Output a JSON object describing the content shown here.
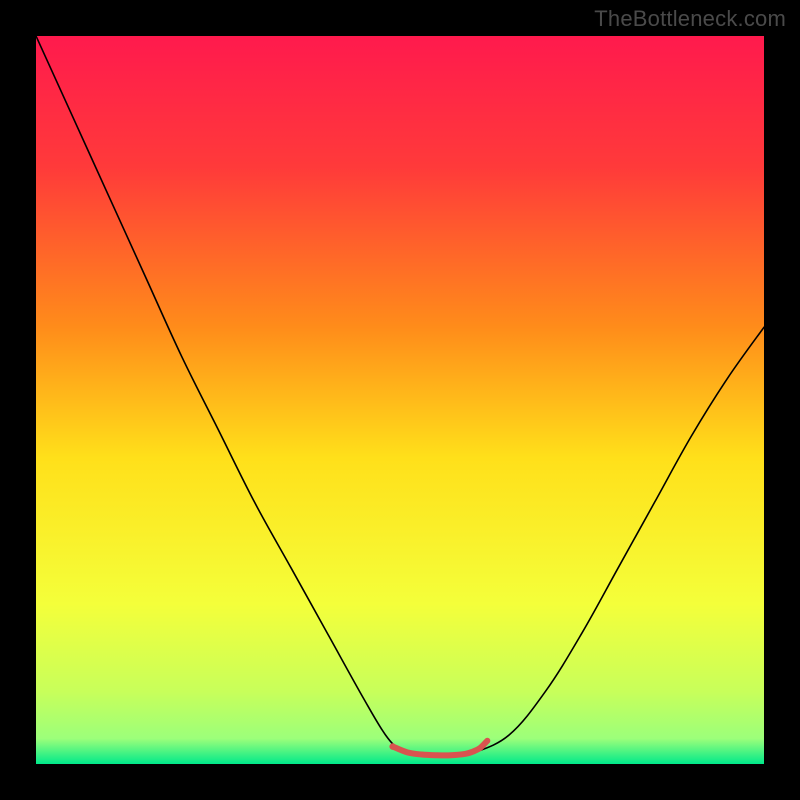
{
  "watermark": "TheBottleneck.com",
  "chart_data": {
    "type": "line",
    "title": "",
    "xlabel": "",
    "ylabel": "",
    "xlim": [
      0,
      100
    ],
    "ylim": [
      0,
      100
    ],
    "grid": false,
    "background_gradient_type": "vertical",
    "background_gradient_stops": [
      {
        "offset": 0.0,
        "color": "#ff1a4d"
      },
      {
        "offset": 0.18,
        "color": "#ff3a3a"
      },
      {
        "offset": 0.4,
        "color": "#ff8c1a"
      },
      {
        "offset": 0.58,
        "color": "#ffe01a"
      },
      {
        "offset": 0.78,
        "color": "#f4ff3a"
      },
      {
        "offset": 0.9,
        "color": "#c8ff5a"
      },
      {
        "offset": 0.965,
        "color": "#9cff7a"
      },
      {
        "offset": 1.0,
        "color": "#00e98a"
      }
    ],
    "series": [
      {
        "name": "bottleneck-curve",
        "color": "#000000",
        "stroke_width": 1.6,
        "x": [
          0,
          5,
          10,
          15,
          20,
          25,
          30,
          35,
          40,
          45,
          48,
          50,
          52,
          55,
          58,
          60,
          65,
          70,
          75,
          80,
          85,
          90,
          95,
          100
        ],
        "y": [
          100,
          89,
          78,
          67,
          56,
          46,
          36,
          27,
          18,
          9,
          4,
          2,
          1.5,
          1.2,
          1.2,
          1.5,
          4,
          10,
          18,
          27,
          36,
          45,
          53,
          60
        ]
      },
      {
        "name": "optimal-band",
        "color": "#d9534f",
        "stroke_width": 6,
        "x": [
          49,
          51,
          53,
          55,
          57,
          59,
          60,
          61,
          62
        ],
        "y": [
          2.4,
          1.6,
          1.3,
          1.2,
          1.2,
          1.4,
          1.7,
          2.2,
          3.2
        ]
      }
    ],
    "annotations": []
  }
}
